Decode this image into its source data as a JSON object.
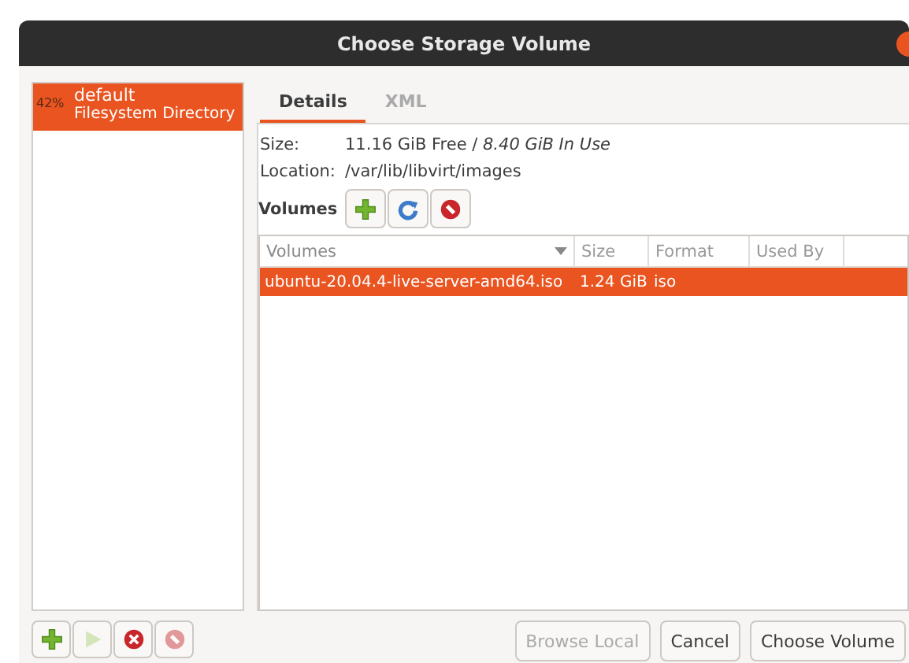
{
  "window": {
    "title": "Choose Storage Volume"
  },
  "pools": [
    {
      "usage": "42%",
      "name": "default",
      "type": "Filesystem Directory",
      "selected": true
    }
  ],
  "tabs": [
    {
      "label": "Details",
      "selected": true
    },
    {
      "label": "XML",
      "selected": false
    }
  ],
  "details": {
    "size_label": "Size:",
    "size_value": "11.16 GiB Free / *8.40 GiB In Use*",
    "location_label": "Location:",
    "location_value": "/var/lib/libvirt/images"
  },
  "volumes_toolbar": {
    "label": "Volumes",
    "buttons": [
      {
        "kind": "add",
        "disabled": false
      },
      {
        "kind": "refresh",
        "disabled": false
      },
      {
        "kind": "delete",
        "disabled": false
      }
    ]
  },
  "table": {
    "columns": [
      {
        "label": "Volumes",
        "sorted": true
      },
      {
        "label": "Size",
        "sorted": false
      },
      {
        "label": "Format",
        "sorted": false
      },
      {
        "label": "Used By",
        "sorted": false
      }
    ],
    "rows": [
      {
        "cells": [
          "ubuntu-20.04.4-live-server-amd64.iso",
          "1.24 GiB",
          "iso",
          ""
        ],
        "selected": true
      }
    ]
  },
  "pool_buttons": [
    {
      "kind": "add",
      "disabled": false
    },
    {
      "kind": "start",
      "disabled": true
    },
    {
      "kind": "stop",
      "disabled": false
    },
    {
      "kind": "delete",
      "disabled": true
    }
  ],
  "buttons": [
    {
      "label": "Browse Local",
      "disabled": true
    },
    {
      "label": "Cancel",
      "disabled": false
    },
    {
      "label": "Choose Volume",
      "disabled": false
    }
  ]
}
